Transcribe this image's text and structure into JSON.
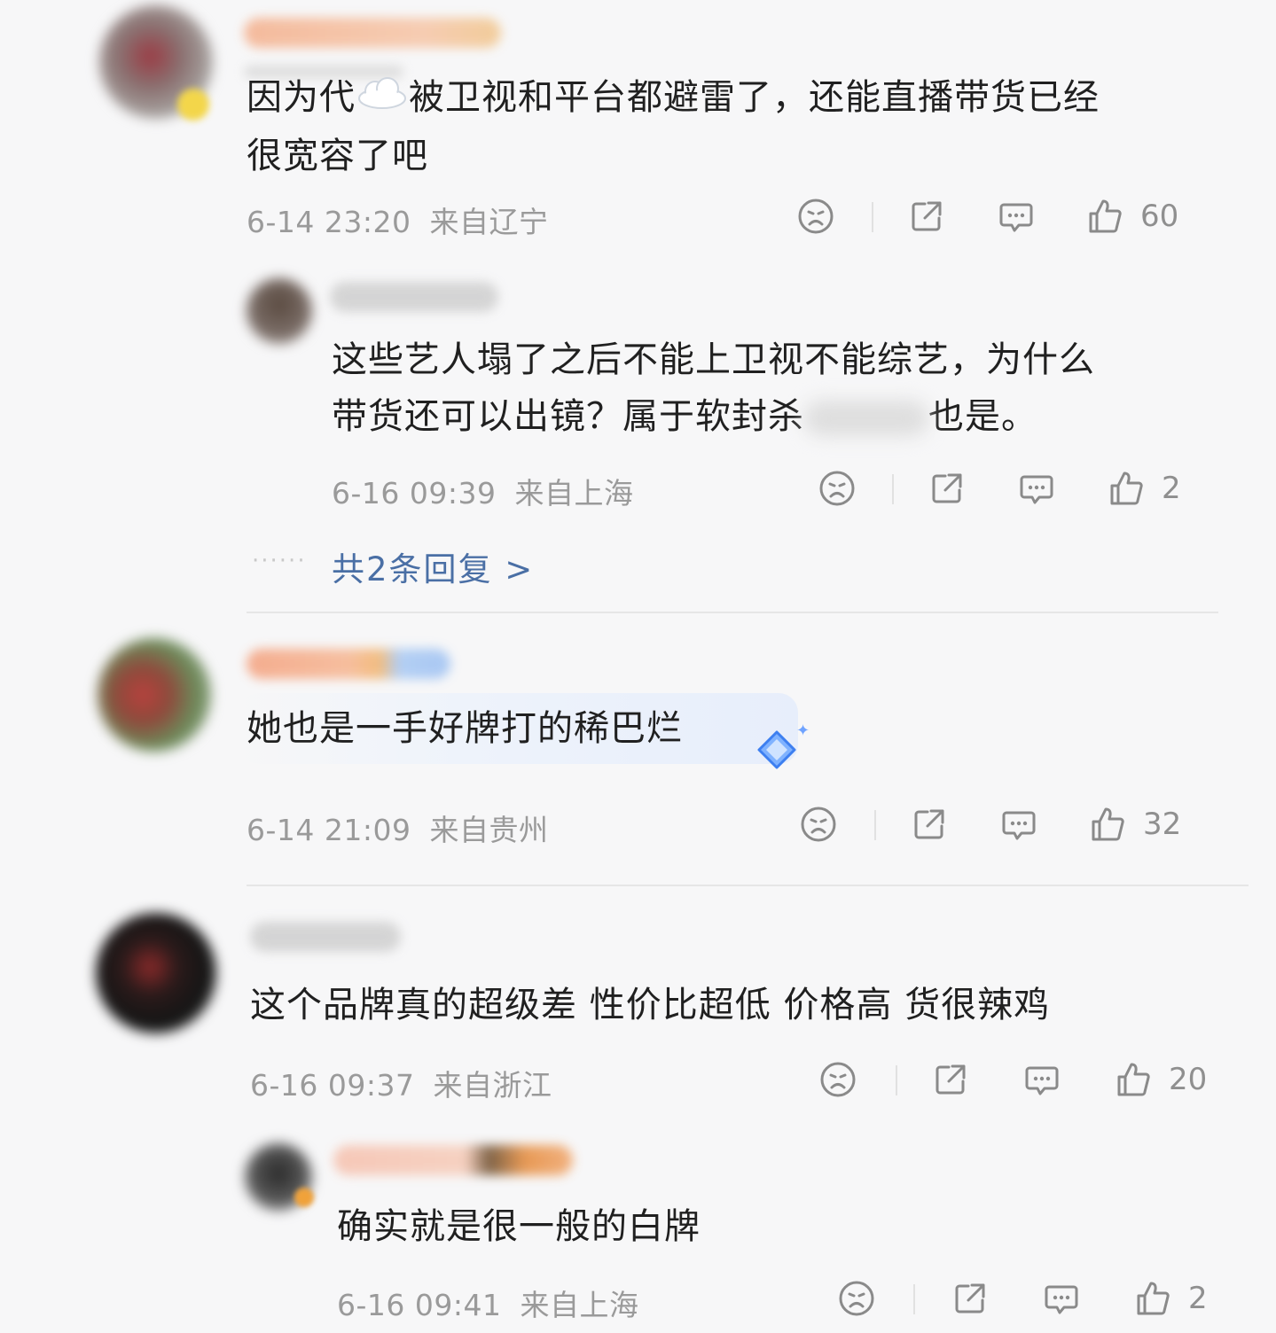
{
  "comments": [
    {
      "text": "因为代",
      "text_after_emoji": "被卫视和平台都避雷了，还能直播带货已经\n很宽容了吧",
      "emoji": "cloud-emoji",
      "time": "6-14 23:20",
      "location": "来自辽宁",
      "likes": "60",
      "reply": {
        "text": "这些艺人塌了之后不能上卫视不能综艺，为什么\n带货还可以出镜？属于软封杀",
        "text_tail": "也是。",
        "time": "6-16 09:39",
        "location": "来自上海",
        "likes": "2"
      },
      "more_replies": "共2条回复 >"
    },
    {
      "text": "她也是一手好牌打的稀巴烂",
      "time": "6-14 21:09",
      "location": "来自贵州",
      "likes": "32"
    },
    {
      "text": "这个品牌真的超级差 性价比超低 价格高 货很辣鸡",
      "time": "6-16 09:37",
      "location": "来自浙江",
      "likes": "20",
      "reply": {
        "text": "确实就是很一般的白牌",
        "time": "6-16 09:41",
        "location": "来自上海",
        "likes": "2"
      }
    }
  ],
  "colors": {
    "background": "#f7f7f8",
    "text": "#202020",
    "meta": "#9a9a9a",
    "link": "#4a6fa5",
    "icon": "#8a8a8a"
  },
  "dots": "······"
}
